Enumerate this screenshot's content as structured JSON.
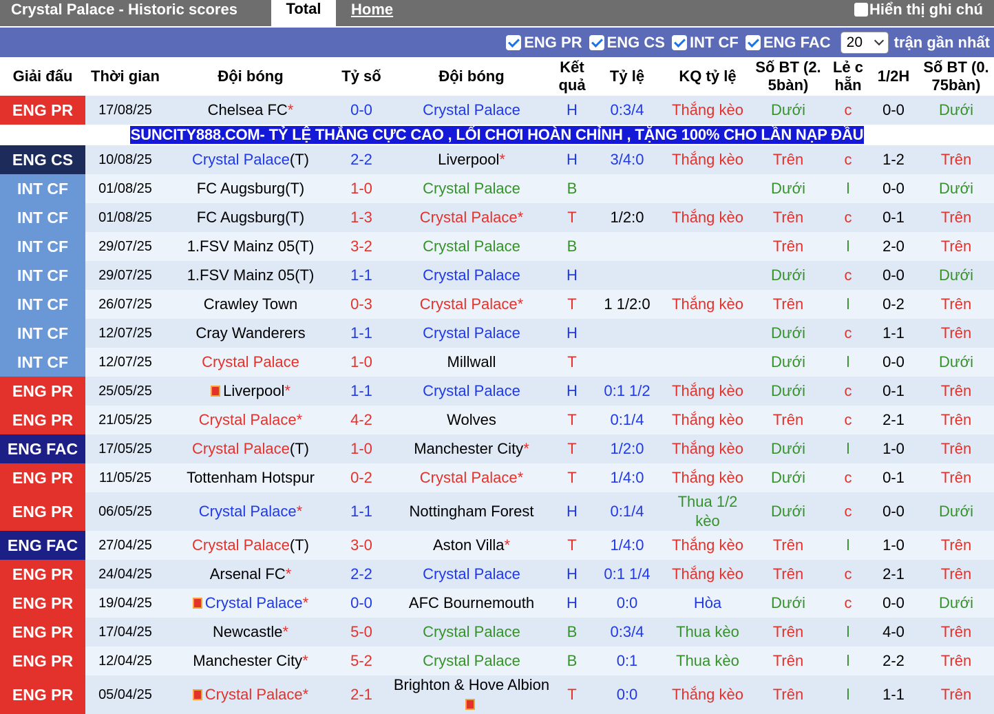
{
  "header": {
    "title": "Crystal Palace - Historic scores",
    "tab_total": "Total",
    "tab_home": "Home",
    "show_notes": "Hiển thị ghi chú"
  },
  "filters": {
    "items": [
      "ENG PR",
      "ENG CS",
      "INT CF",
      "ENG FAC"
    ],
    "count": "20",
    "count_suffix": "trận gần nhất"
  },
  "columns": [
    "Giải đấu",
    "Thời gian",
    "Đội bóng",
    "Tỷ số",
    "Đội bóng",
    "Kết quả",
    "Tỷ lệ",
    "KQ tỷ lệ",
    "Số BT (2. 5bàn)",
    "Lẻ c hẵn",
    "1/2H",
    "Số BT (0. 75bàn)"
  ],
  "ad": "SUNCITY888.COM- TỶ LỆ THẮNG CỰC CAO , LỐI CHƠI HOÀN CHỈNH , TẶNG 100% CHO LẦN NẠP ĐẦU",
  "colors": {
    "eng_pr": "#e3322b",
    "eng_cs": "#1d2b5b",
    "int_cf": "#6a97d6",
    "eng_fac": "#1b1f86",
    "win": "#e3322b",
    "draw": "#2039e6",
    "loss": "#35922a"
  },
  "matches": [
    {
      "league": "ENG PR",
      "lg": "pr",
      "date": "17/08/25",
      "home": "Chelsea FC",
      "home_star": "*",
      "home_cls": "",
      "home_suffix": "",
      "home_flag": false,
      "score": "0-0",
      "score_cls": "blue",
      "away": "Crystal Palace",
      "away_cls": "cp",
      "away_star": "",
      "away_suffix": "",
      "away_flag": false,
      "result": "H",
      "result_cls": "blue",
      "odds": "0:3/4",
      "odds_cls": "blue",
      "odds_result": "Thắng kèo",
      "or_cls": "red",
      "ou": "Dưới",
      "ou_cls": "green",
      "oe": "c",
      "oe_cls": "red",
      "half": "0-0",
      "ou2": "Dưới",
      "ou2_cls": "green"
    },
    {
      "league": "ENG CS",
      "lg": "cs",
      "date": "10/08/25",
      "home": "Crystal Palace",
      "home_star": "",
      "home_cls": "cp",
      "home_suffix": "(T)",
      "home_flag": false,
      "score": "2-2",
      "score_cls": "blue",
      "away": "Liverpool",
      "away_cls": "",
      "away_star": "*",
      "away_suffix": "",
      "away_flag": false,
      "result": "H",
      "result_cls": "blue",
      "odds": "3/4:0",
      "odds_cls": "blue",
      "odds_result": "Thắng kèo",
      "or_cls": "red",
      "ou": "Trên",
      "ou_cls": "red",
      "oe": "c",
      "oe_cls": "red",
      "half": "1-2",
      "ou2": "Trên",
      "ou2_cls": "red"
    },
    {
      "league": "INT CF",
      "lg": "cf",
      "date": "01/08/25",
      "home": "FC Augsburg",
      "home_star": "",
      "home_cls": "",
      "home_suffix": "(T)",
      "home_flag": false,
      "score": "1-0",
      "score_cls": "red",
      "away": "Crystal Palace",
      "away_cls": "green",
      "away_star": "",
      "away_suffix": "",
      "away_flag": false,
      "result": "B",
      "result_cls": "green",
      "odds": "",
      "odds_cls": "",
      "odds_result": "",
      "or_cls": "",
      "ou": "Dưới",
      "ou_cls": "green",
      "oe": "l",
      "oe_cls": "green",
      "half": "0-0",
      "ou2": "Dưới",
      "ou2_cls": "green"
    },
    {
      "league": "INT CF",
      "lg": "cf",
      "date": "01/08/25",
      "home": "FC Augsburg",
      "home_star": "",
      "home_cls": "",
      "home_suffix": "(T)",
      "home_flag": false,
      "score": "1-3",
      "score_cls": "red",
      "away": "Crystal Palace",
      "away_cls": "cpr",
      "away_star": "*",
      "away_suffix": "",
      "away_flag": false,
      "result": "T",
      "result_cls": "red",
      "odds": "1/2:0",
      "odds_cls": "",
      "odds_result": "Thắng kèo",
      "or_cls": "red",
      "ou": "Trên",
      "ou_cls": "red",
      "oe": "c",
      "oe_cls": "red",
      "half": "0-1",
      "ou2": "Trên",
      "ou2_cls": "red"
    },
    {
      "league": "INT CF",
      "lg": "cf",
      "date": "29/07/25",
      "home": "1.FSV Mainz 05",
      "home_star": "",
      "home_cls": "",
      "home_suffix": "(T)",
      "home_flag": false,
      "score": "3-2",
      "score_cls": "red",
      "away": "Crystal Palace",
      "away_cls": "green",
      "away_star": "",
      "away_suffix": "",
      "away_flag": false,
      "result": "B",
      "result_cls": "green",
      "odds": "",
      "odds_cls": "",
      "odds_result": "",
      "or_cls": "",
      "ou": "Trên",
      "ou_cls": "red",
      "oe": "l",
      "oe_cls": "green",
      "half": "2-0",
      "ou2": "Trên",
      "ou2_cls": "red"
    },
    {
      "league": "INT CF",
      "lg": "cf",
      "date": "29/07/25",
      "home": "1.FSV Mainz 05",
      "home_star": "",
      "home_cls": "",
      "home_suffix": "(T)",
      "home_flag": false,
      "score": "1-1",
      "score_cls": "blue",
      "away": "Crystal Palace",
      "away_cls": "cp",
      "away_star": "",
      "away_suffix": "",
      "away_flag": false,
      "result": "H",
      "result_cls": "blue",
      "odds": "",
      "odds_cls": "",
      "odds_result": "",
      "or_cls": "",
      "ou": "Dưới",
      "ou_cls": "green",
      "oe": "c",
      "oe_cls": "red",
      "half": "0-0",
      "ou2": "Dưới",
      "ou2_cls": "green"
    },
    {
      "league": "INT CF",
      "lg": "cf",
      "date": "26/07/25",
      "home": "Crawley Town",
      "home_star": "",
      "home_cls": "",
      "home_suffix": "",
      "home_flag": false,
      "score": "0-3",
      "score_cls": "red",
      "away": "Crystal Palace",
      "away_cls": "cpr",
      "away_star": "*",
      "away_suffix": "",
      "away_flag": false,
      "result": "T",
      "result_cls": "red",
      "odds": "1 1/2:0",
      "odds_cls": "",
      "odds_result": "Thắng kèo",
      "or_cls": "red",
      "ou": "Trên",
      "ou_cls": "red",
      "oe": "l",
      "oe_cls": "green",
      "half": "0-2",
      "ou2": "Trên",
      "ou2_cls": "red"
    },
    {
      "league": "INT CF",
      "lg": "cf",
      "date": "12/07/25",
      "home": "Cray Wanderers",
      "home_star": "",
      "home_cls": "",
      "home_suffix": "",
      "home_flag": false,
      "score": "1-1",
      "score_cls": "blue",
      "away": "Crystal Palace",
      "away_cls": "cp",
      "away_star": "",
      "away_suffix": "",
      "away_flag": false,
      "result": "H",
      "result_cls": "blue",
      "odds": "",
      "odds_cls": "",
      "odds_result": "",
      "or_cls": "",
      "ou": "Dưới",
      "ou_cls": "green",
      "oe": "c",
      "oe_cls": "red",
      "half": "1-1",
      "ou2": "Trên",
      "ou2_cls": "red"
    },
    {
      "league": "INT CF",
      "lg": "cf",
      "date": "12/07/25",
      "home": "Crystal Palace",
      "home_star": "",
      "home_cls": "cpr",
      "home_suffix": "",
      "home_flag": false,
      "score": "1-0",
      "score_cls": "red",
      "away": "Millwall",
      "away_cls": "",
      "away_star": "",
      "away_suffix": "",
      "away_flag": false,
      "result": "T",
      "result_cls": "red",
      "odds": "",
      "odds_cls": "",
      "odds_result": "",
      "or_cls": "",
      "ou": "Dưới",
      "ou_cls": "green",
      "oe": "l",
      "oe_cls": "green",
      "half": "0-0",
      "ou2": "Dưới",
      "ou2_cls": "green"
    },
    {
      "league": "ENG PR",
      "lg": "pr",
      "date": "25/05/25",
      "home": "Liverpool",
      "home_star": "*",
      "home_cls": "",
      "home_suffix": "",
      "home_flag": true,
      "score": "1-1",
      "score_cls": "blue",
      "away": "Crystal Palace",
      "away_cls": "cp",
      "away_star": "",
      "away_suffix": "",
      "away_flag": false,
      "result": "H",
      "result_cls": "blue",
      "odds": "0:1 1/2",
      "odds_cls": "blue",
      "odds_result": "Thắng kèo",
      "or_cls": "red",
      "ou": "Dưới",
      "ou_cls": "green",
      "oe": "c",
      "oe_cls": "red",
      "half": "0-1",
      "ou2": "Trên",
      "ou2_cls": "red"
    },
    {
      "league": "ENG PR",
      "lg": "pr",
      "date": "21/05/25",
      "home": "Crystal Palace",
      "home_star": "*",
      "home_cls": "cpr",
      "home_suffix": "",
      "home_flag": false,
      "score": "4-2",
      "score_cls": "red",
      "away": "Wolves",
      "away_cls": "",
      "away_star": "",
      "away_suffix": "",
      "away_flag": false,
      "result": "T",
      "result_cls": "red",
      "odds": "0:1/4",
      "odds_cls": "blue",
      "odds_result": "Thắng kèo",
      "or_cls": "red",
      "ou": "Trên",
      "ou_cls": "red",
      "oe": "c",
      "oe_cls": "red",
      "half": "2-1",
      "ou2": "Trên",
      "ou2_cls": "red"
    },
    {
      "league": "ENG FAC",
      "lg": "fac",
      "date": "17/05/25",
      "home": "Crystal Palace",
      "home_star": "",
      "home_cls": "cpr",
      "home_suffix": "(T)",
      "home_flag": false,
      "score": "1-0",
      "score_cls": "red",
      "away": "Manchester City",
      "away_cls": "",
      "away_star": "*",
      "away_suffix": "",
      "away_flag": false,
      "result": "T",
      "result_cls": "red",
      "odds": "1/2:0",
      "odds_cls": "blue",
      "odds_result": "Thắng kèo",
      "or_cls": "red",
      "ou": "Dưới",
      "ou_cls": "green",
      "oe": "l",
      "oe_cls": "green",
      "half": "1-0",
      "ou2": "Trên",
      "ou2_cls": "red"
    },
    {
      "league": "ENG PR",
      "lg": "pr",
      "date": "11/05/25",
      "home": "Tottenham Hotspur",
      "home_star": "",
      "home_cls": "",
      "home_suffix": "",
      "home_flag": false,
      "score": "0-2",
      "score_cls": "red",
      "away": "Crystal Palace",
      "away_cls": "cpr",
      "away_star": "*",
      "away_suffix": "",
      "away_flag": false,
      "result": "T",
      "result_cls": "red",
      "odds": "1/4:0",
      "odds_cls": "blue",
      "odds_result": "Thắng kèo",
      "or_cls": "red",
      "ou": "Dưới",
      "ou_cls": "green",
      "oe": "c",
      "oe_cls": "red",
      "half": "0-1",
      "ou2": "Trên",
      "ou2_cls": "red"
    },
    {
      "league": "ENG PR",
      "lg": "pr",
      "date": "06/05/25",
      "home": "Crystal Palace",
      "home_star": "*",
      "home_cls": "cp",
      "home_suffix": "",
      "home_flag": false,
      "score": "1-1",
      "score_cls": "blue",
      "away": "Nottingham Forest",
      "away_cls": "",
      "away_star": "",
      "away_suffix": "",
      "away_flag": false,
      "result": "H",
      "result_cls": "blue",
      "odds": "0:1/4",
      "odds_cls": "blue",
      "odds_result": "Thua 1/2 kèo",
      "or_cls": "green",
      "ou": "Dưới",
      "ou_cls": "green",
      "oe": "c",
      "oe_cls": "red",
      "half": "0-0",
      "ou2": "Dưới",
      "ou2_cls": "green",
      "tall": true
    },
    {
      "league": "ENG FAC",
      "lg": "fac",
      "date": "27/04/25",
      "home": "Crystal Palace",
      "home_star": "",
      "home_cls": "cpr",
      "home_suffix": "(T)",
      "home_flag": false,
      "score": "3-0",
      "score_cls": "red",
      "away": "Aston Villa",
      "away_cls": "",
      "away_star": "*",
      "away_suffix": "",
      "away_flag": false,
      "result": "T",
      "result_cls": "red",
      "odds": "1/4:0",
      "odds_cls": "blue",
      "odds_result": "Thắng kèo",
      "or_cls": "red",
      "ou": "Trên",
      "ou_cls": "red",
      "oe": "l",
      "oe_cls": "green",
      "half": "1-0",
      "ou2": "Trên",
      "ou2_cls": "red"
    },
    {
      "league": "ENG PR",
      "lg": "pr",
      "date": "24/04/25",
      "home": "Arsenal FC",
      "home_star": "*",
      "home_cls": "",
      "home_suffix": "",
      "home_flag": false,
      "score": "2-2",
      "score_cls": "blue",
      "away": "Crystal Palace",
      "away_cls": "cp",
      "away_star": "",
      "away_suffix": "",
      "away_flag": false,
      "result": "H",
      "result_cls": "blue",
      "odds": "0:1 1/4",
      "odds_cls": "blue",
      "odds_result": "Thắng kèo",
      "or_cls": "red",
      "ou": "Trên",
      "ou_cls": "red",
      "oe": "c",
      "oe_cls": "red",
      "half": "2-1",
      "ou2": "Trên",
      "ou2_cls": "red"
    },
    {
      "league": "ENG PR",
      "lg": "pr",
      "date": "19/04/25",
      "home": "Crystal Palace",
      "home_star": "*",
      "home_cls": "cp",
      "home_suffix": "",
      "home_flag": true,
      "score": "0-0",
      "score_cls": "blue",
      "away": "AFC Bournemouth",
      "away_cls": "",
      "away_star": "",
      "away_suffix": "",
      "away_flag": false,
      "result": "H",
      "result_cls": "blue",
      "odds": "0:0",
      "odds_cls": "blue",
      "odds_result": "Hòa",
      "or_cls": "blue",
      "ou": "Dưới",
      "ou_cls": "green",
      "oe": "c",
      "oe_cls": "red",
      "half": "0-0",
      "ou2": "Dưới",
      "ou2_cls": "green"
    },
    {
      "league": "ENG PR",
      "lg": "pr",
      "date": "17/04/25",
      "home": "Newcastle",
      "home_star": "*",
      "home_cls": "",
      "home_suffix": "",
      "home_flag": false,
      "score": "5-0",
      "score_cls": "red",
      "away": "Crystal Palace",
      "away_cls": "green",
      "away_star": "",
      "away_suffix": "",
      "away_flag": false,
      "result": "B",
      "result_cls": "green",
      "odds": "0:3/4",
      "odds_cls": "blue",
      "odds_result": "Thua kèo",
      "or_cls": "green",
      "ou": "Trên",
      "ou_cls": "red",
      "oe": "l",
      "oe_cls": "green",
      "half": "4-0",
      "ou2": "Trên",
      "ou2_cls": "red"
    },
    {
      "league": "ENG PR",
      "lg": "pr",
      "date": "12/04/25",
      "home": "Manchester City",
      "home_star": "*",
      "home_cls": "",
      "home_suffix": "",
      "home_flag": false,
      "score": "5-2",
      "score_cls": "red",
      "away": "Crystal Palace",
      "away_cls": "green",
      "away_star": "",
      "away_suffix": "",
      "away_flag": false,
      "result": "B",
      "result_cls": "green",
      "odds": "0:1",
      "odds_cls": "blue",
      "odds_result": "Thua kèo",
      "or_cls": "green",
      "ou": "Trên",
      "ou_cls": "red",
      "oe": "l",
      "oe_cls": "green",
      "half": "2-2",
      "ou2": "Trên",
      "ou2_cls": "red"
    },
    {
      "league": "ENG PR",
      "lg": "pr",
      "date": "05/04/25",
      "home": "Crystal Palace",
      "home_star": "*",
      "home_cls": "cpr",
      "home_suffix": "",
      "home_flag": true,
      "score": "2-1",
      "score_cls": "red",
      "away": "Brighton & Hove Albion",
      "away_cls": "",
      "away_star": "",
      "away_suffix": "",
      "away_flag": true,
      "result": "T",
      "result_cls": "red",
      "odds": "0:0",
      "odds_cls": "blue",
      "odds_result": "Thắng kèo",
      "or_cls": "red",
      "ou": "Trên",
      "ou_cls": "red",
      "oe": "l",
      "oe_cls": "green",
      "half": "1-1",
      "ou2": "Trên",
      "ou2_cls": "red",
      "tall": true
    }
  ]
}
